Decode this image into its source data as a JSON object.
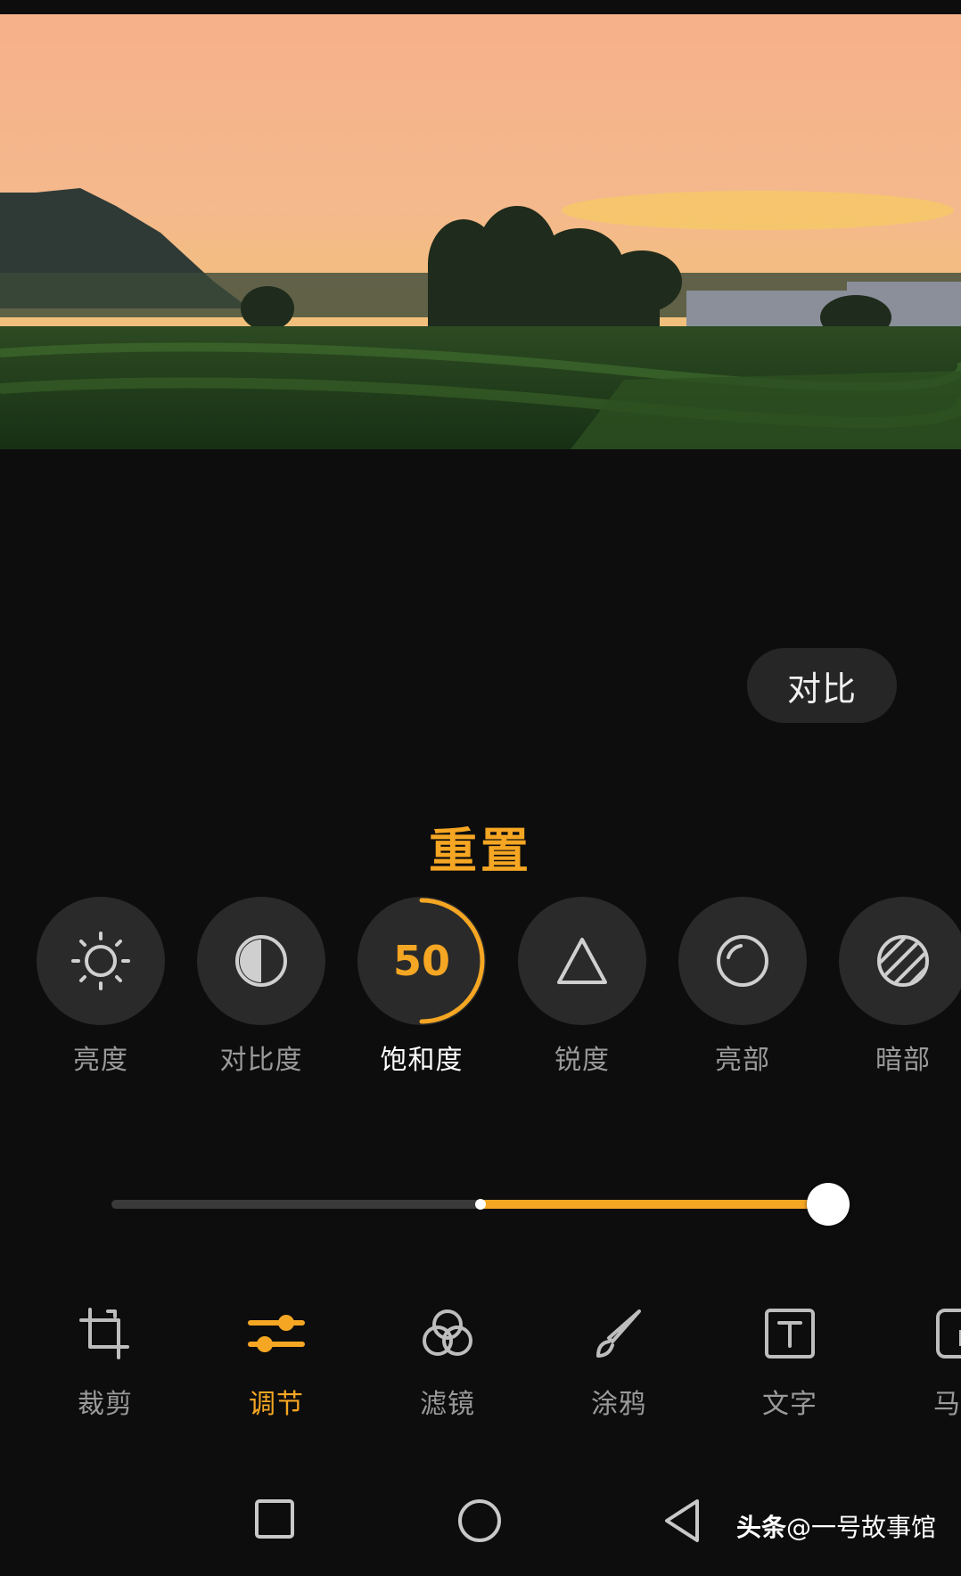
{
  "compare_label": "对比",
  "reset_label": "重置",
  "adjust_tools": [
    {
      "label": "亮度",
      "icon": "sun-icon"
    },
    {
      "label": "对比度",
      "icon": "contrast-icon"
    },
    {
      "label": "饱和度",
      "icon": "saturation-icon",
      "value": "50",
      "active": true
    },
    {
      "label": "锐度",
      "icon": "triangle-icon"
    },
    {
      "label": "亮部",
      "icon": "highlights-icon"
    },
    {
      "label": "暗部",
      "icon": "shadows-icon"
    }
  ],
  "slider": {
    "value_fraction": 1.0,
    "center_fraction": 0.5
  },
  "bottom_nav": [
    {
      "label": "裁剪",
      "icon": "crop-icon"
    },
    {
      "label": "调节",
      "icon": "adjust-icon",
      "active": true
    },
    {
      "label": "滤镜",
      "icon": "filter-icon"
    },
    {
      "label": "涂鸦",
      "icon": "brush-icon"
    },
    {
      "label": "文字",
      "icon": "text-icon"
    },
    {
      "label": "马赛",
      "icon": "mosaic-icon"
    }
  ],
  "watermark": {
    "brand": "头条",
    "handle": "@一号故事馆"
  },
  "colors": {
    "accent": "#f5a623",
    "background": "#0d0d0d",
    "button": "#2a2a2a"
  }
}
